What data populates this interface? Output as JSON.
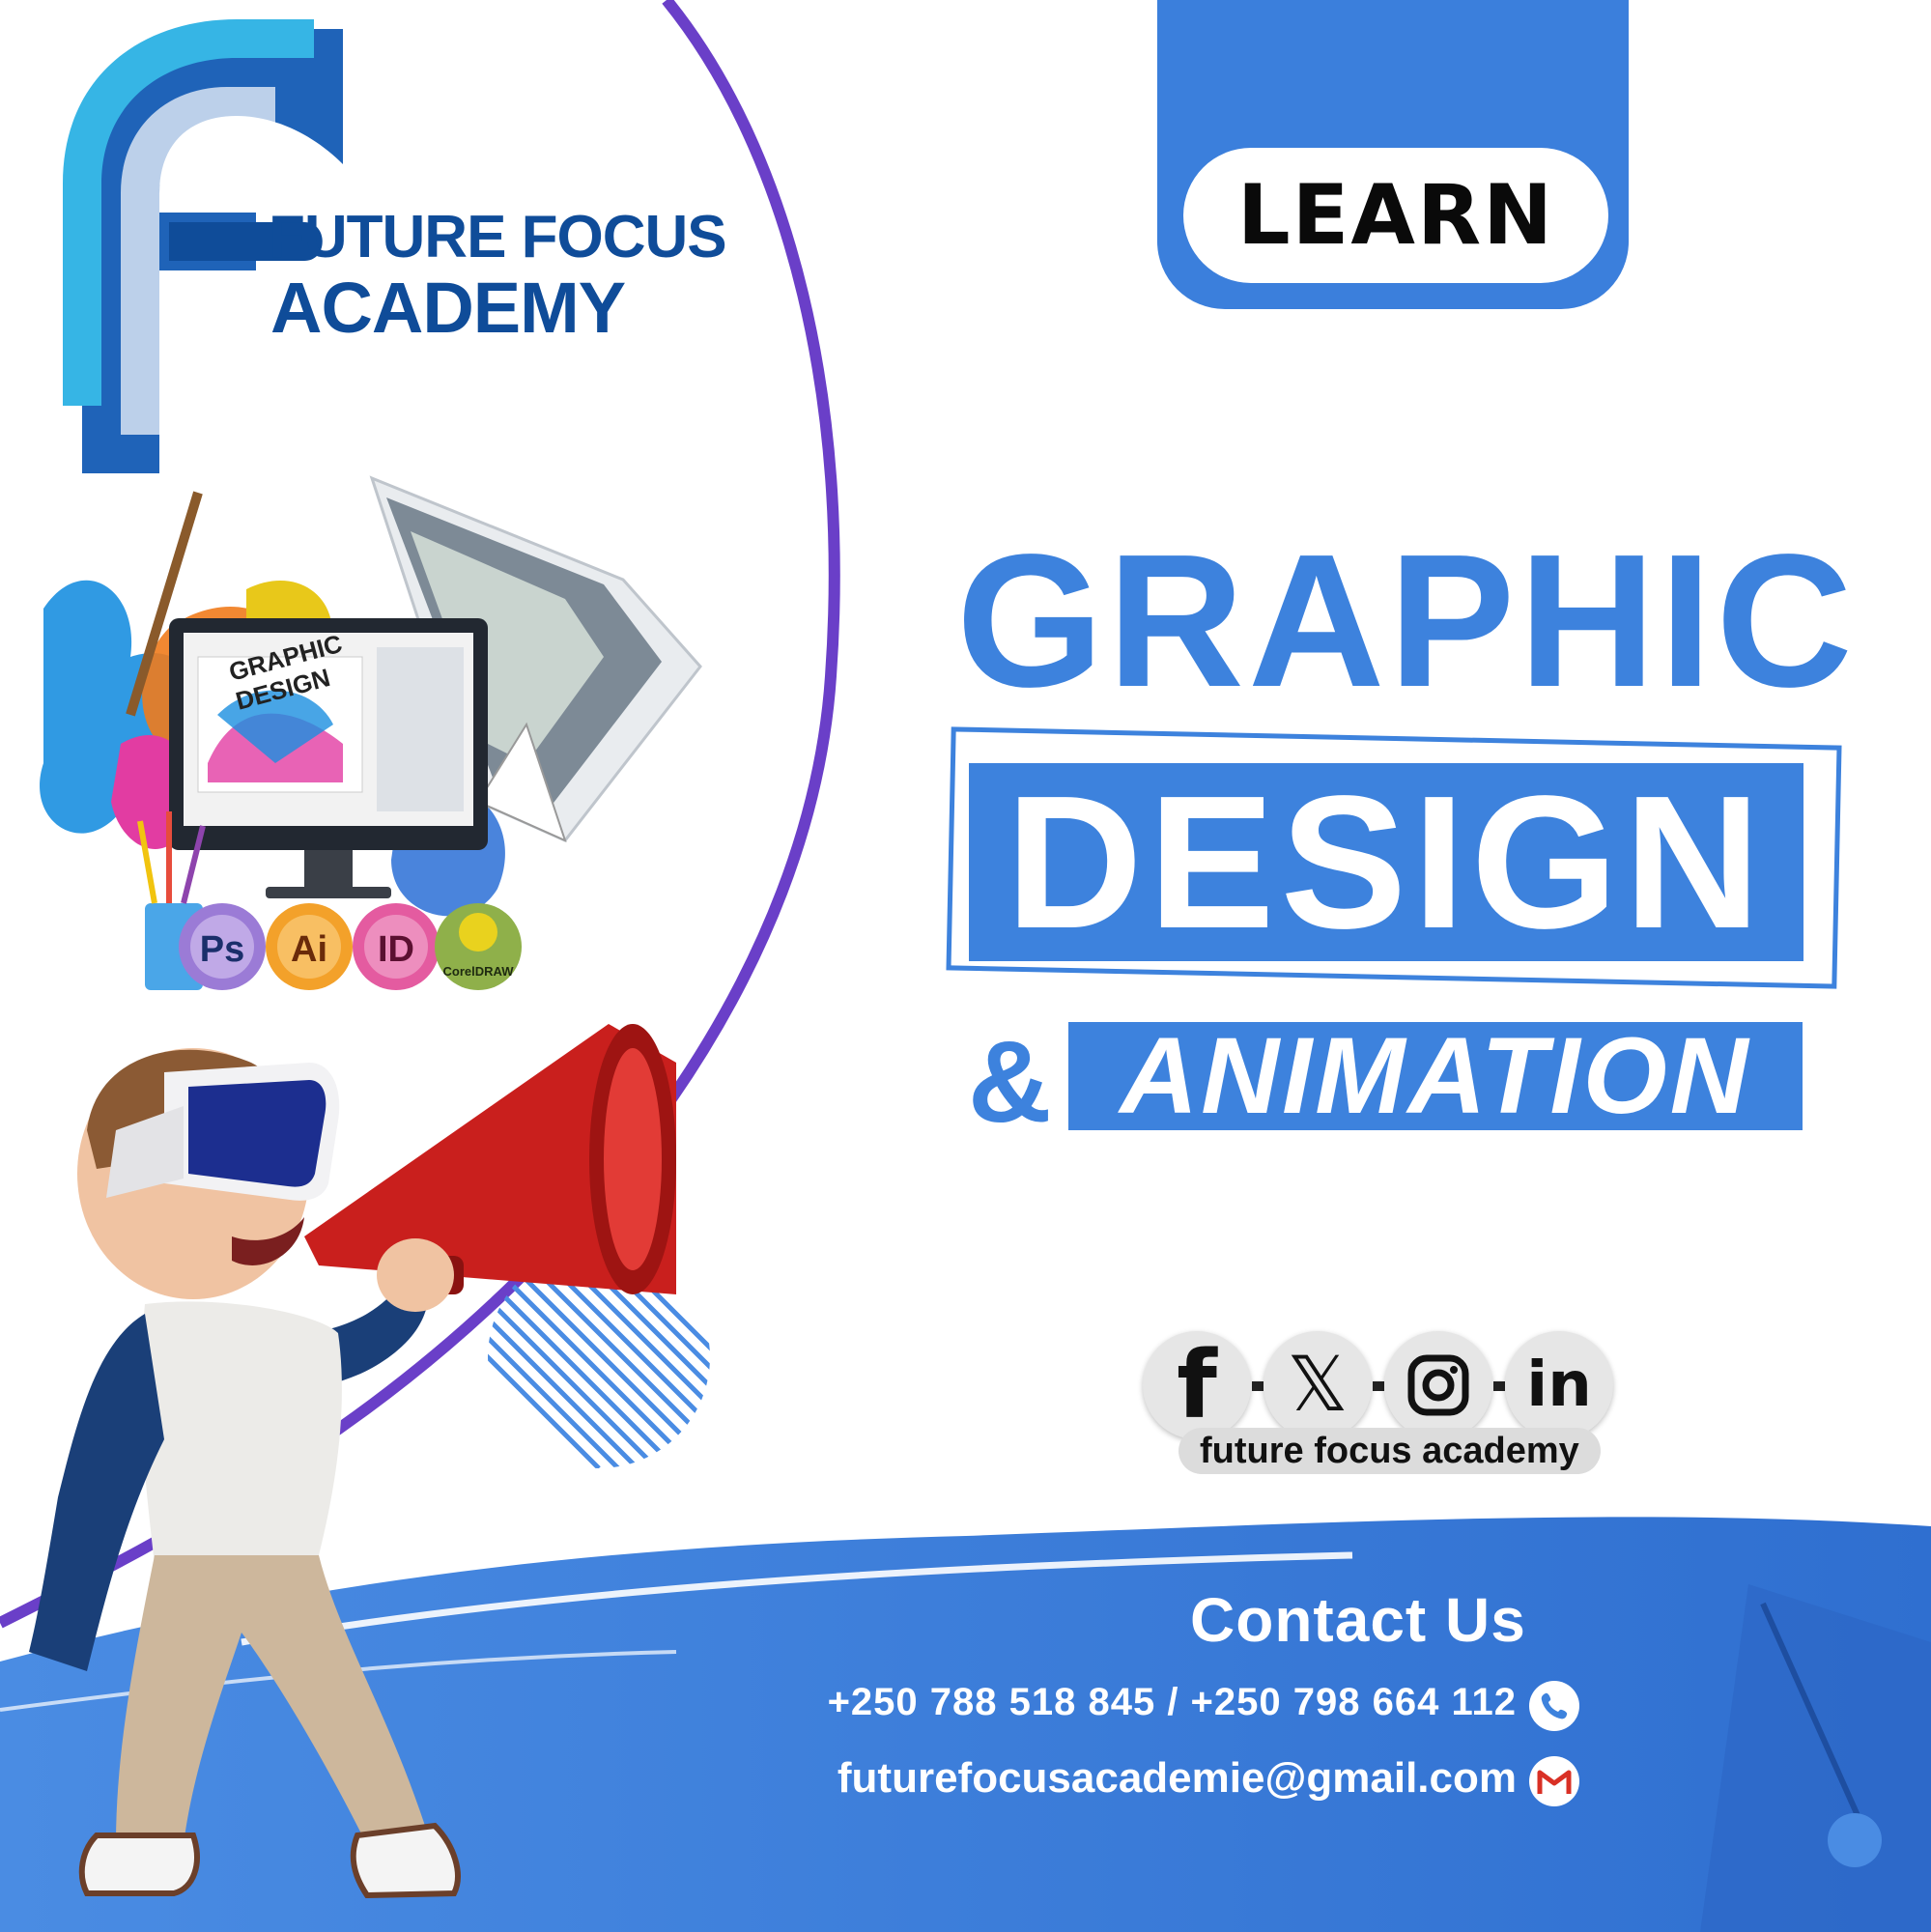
{
  "brand": {
    "name_line1": "FUTURE FOCUS",
    "name_line2": "ACADEMY"
  },
  "learn_label": "LEARN",
  "headline": {
    "line1": "GRAPHIC",
    "line2": "DESIGN",
    "ampersand": "&",
    "line3": "ANIMATION"
  },
  "software_badges": [
    "Ps",
    "Ai",
    "ID",
    "CorelDRAW"
  ],
  "collage_screen_text": [
    "GRAPHIC",
    "DESIGN"
  ],
  "social": {
    "icons": [
      "facebook-icon",
      "x-icon",
      "instagram-icon",
      "linkedin-icon"
    ],
    "facebook_glyph": "f",
    "x_glyph": "𝕏",
    "linkedin_glyph": "in",
    "handle": "future focus academy"
  },
  "contact": {
    "title": "Contact Us",
    "phones": "+250 788 518 845 / +250 798 664 112",
    "email": "futurefocusacademie@gmail.com",
    "phone_icon": "phone-icon",
    "email_icon": "gmail-icon"
  },
  "colors": {
    "primary_blue": "#3d82dd",
    "dark_blue": "#0f4c99",
    "purple_arc": "#6a3fc8",
    "megaphone_red": "#d42a27",
    "white": "#ffffff"
  }
}
